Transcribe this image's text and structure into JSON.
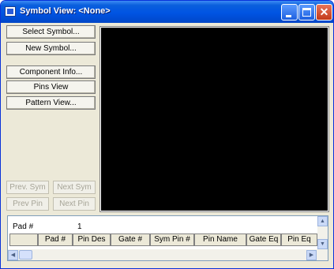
{
  "window": {
    "title": "Symbol View: <None>"
  },
  "sidebar": {
    "select_symbol": "Select Symbol...",
    "new_symbol": "New Symbol...",
    "component_info": "Component Info...",
    "pins_view": "Pins View",
    "pattern_view": "Pattern View...",
    "prev_sym": "Prev. Sym",
    "next_sym": "Next Sym",
    "prev_pin": "Prev Pin",
    "next_pin": "Next Pin"
  },
  "pins_grid": {
    "pad_label": "Pad #",
    "pad_value": "1",
    "columns": [
      "",
      "Pad #",
      "Pin Des",
      "Gate #",
      "Sym Pin #",
      "Pin Name",
      "Gate Eq",
      "Pin Eq"
    ]
  },
  "colors": {
    "titlebar": "#0054e3",
    "window_bg": "#ece9d8",
    "preview_bg": "#000000",
    "close_button": "#c23a1a"
  },
  "icons": [
    "app-icon",
    "minimize-icon",
    "maximize-icon",
    "close-icon",
    "scroll-up-arrow-icon",
    "scroll-down-arrow-icon",
    "scroll-left-arrow-icon",
    "scroll-right-arrow-icon"
  ]
}
